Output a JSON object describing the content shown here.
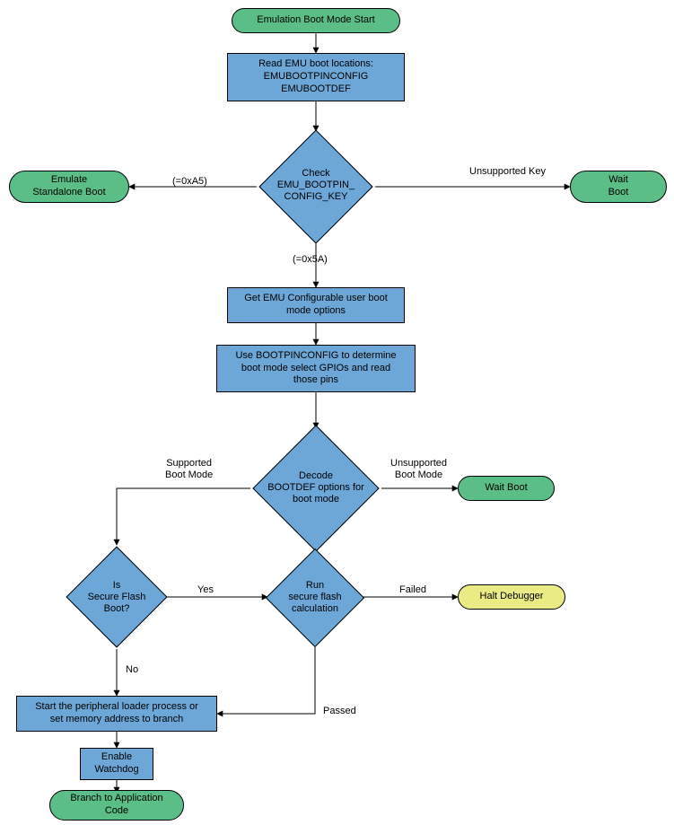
{
  "nodes": {
    "start": "Emulation Boot Mode Start",
    "read_emu": "Read EMU boot locations:\nEMUBOOTPINCONFIG\nEMUBOOTDEF",
    "check_key": "Check\nEMU_BOOTPIN_\nCONFIG_KEY",
    "emu_standalone": "Emulate\nStandalone Boot",
    "wait_boot_top": "Wait\nBoot",
    "get_emu": "Get EMU Configurable user boot\nmode options",
    "use_bpc": "Use BOOTPINCONFIG to determine\nboot mode select GPIOs and read\nthose pins",
    "decode_bootdef": "Decode\nBOOTDEF options for\nboot mode",
    "wait_boot_mid": "Wait Boot",
    "is_secure": "Is\nSecure Flash\nBoot?",
    "run_secure": "Run\nsecure flash\ncalculation",
    "halt_dbg": "Halt Debugger",
    "start_loader": "Start the peripheral loader process or\nset memory address to branch",
    "enable_wd": "Enable\nWatchdog",
    "branch_app": "Branch to Application\nCode"
  },
  "edges": {
    "a5": "(=0xA5)",
    "five_a": "(=0x5A)",
    "unsup_key": "Unsupported Key",
    "sup_bm": "Supported\nBoot Mode",
    "unsup_bm": "Unsupported\nBoot Mode",
    "yes": "Yes",
    "no": "No",
    "failed": "Failed",
    "passed": "Passed"
  },
  "chart_data": {
    "type": "flowchart",
    "nodes": [
      {
        "id": "start",
        "kind": "terminator",
        "label": "Emulation Boot Mode Start"
      },
      {
        "id": "read_emu",
        "kind": "process",
        "label": "Read EMU boot locations:\nEMUBOOTPINCONFIG\nEMUBOOTDEF"
      },
      {
        "id": "check_key",
        "kind": "decision",
        "label": "Check EMU_BOOTPIN_CONFIG_KEY"
      },
      {
        "id": "emu_standalone",
        "kind": "terminator",
        "label": "Emulate Standalone Boot"
      },
      {
        "id": "wait_boot_top",
        "kind": "terminator",
        "label": "Wait Boot"
      },
      {
        "id": "get_emu",
        "kind": "process",
        "label": "Get EMU Configurable user boot mode options"
      },
      {
        "id": "use_bpc",
        "kind": "process",
        "label": "Use BOOTPINCONFIG to determine boot mode select GPIOs and read those pins"
      },
      {
        "id": "decode_bootdef",
        "kind": "decision",
        "label": "Decode BOOTDEF options for boot mode"
      },
      {
        "id": "wait_boot_mid",
        "kind": "terminator",
        "label": "Wait Boot"
      },
      {
        "id": "is_secure",
        "kind": "decision",
        "label": "Is Secure Flash Boot?"
      },
      {
        "id": "run_secure",
        "kind": "decision",
        "label": "Run secure flash calculation"
      },
      {
        "id": "halt_dbg",
        "kind": "terminator",
        "label": "Halt Debugger"
      },
      {
        "id": "start_loader",
        "kind": "process",
        "label": "Start the peripheral loader process or set memory address to branch"
      },
      {
        "id": "enable_wd",
        "kind": "process",
        "label": "Enable Watchdog"
      },
      {
        "id": "branch_app",
        "kind": "terminator",
        "label": "Branch to Application Code"
      }
    ],
    "edges": [
      {
        "from": "start",
        "to": "read_emu"
      },
      {
        "from": "read_emu",
        "to": "check_key"
      },
      {
        "from": "check_key",
        "to": "emu_standalone",
        "label": "(=0xA5)"
      },
      {
        "from": "check_key",
        "to": "wait_boot_top",
        "label": "Unsupported Key"
      },
      {
        "from": "check_key",
        "to": "get_emu",
        "label": "(=0x5A)"
      },
      {
        "from": "get_emu",
        "to": "use_bpc"
      },
      {
        "from": "use_bpc",
        "to": "decode_bootdef"
      },
      {
        "from": "decode_bootdef",
        "to": "is_secure",
        "label": "Supported Boot Mode"
      },
      {
        "from": "decode_bootdef",
        "to": "wait_boot_mid",
        "label": "Unsupported Boot Mode"
      },
      {
        "from": "is_secure",
        "to": "run_secure",
        "label": "Yes"
      },
      {
        "from": "is_secure",
        "to": "start_loader",
        "label": "No"
      },
      {
        "from": "run_secure",
        "to": "halt_dbg",
        "label": "Failed"
      },
      {
        "from": "run_secure",
        "to": "start_loader",
        "label": "Passed"
      },
      {
        "from": "start_loader",
        "to": "enable_wd"
      },
      {
        "from": "enable_wd",
        "to": "branch_app"
      }
    ]
  }
}
